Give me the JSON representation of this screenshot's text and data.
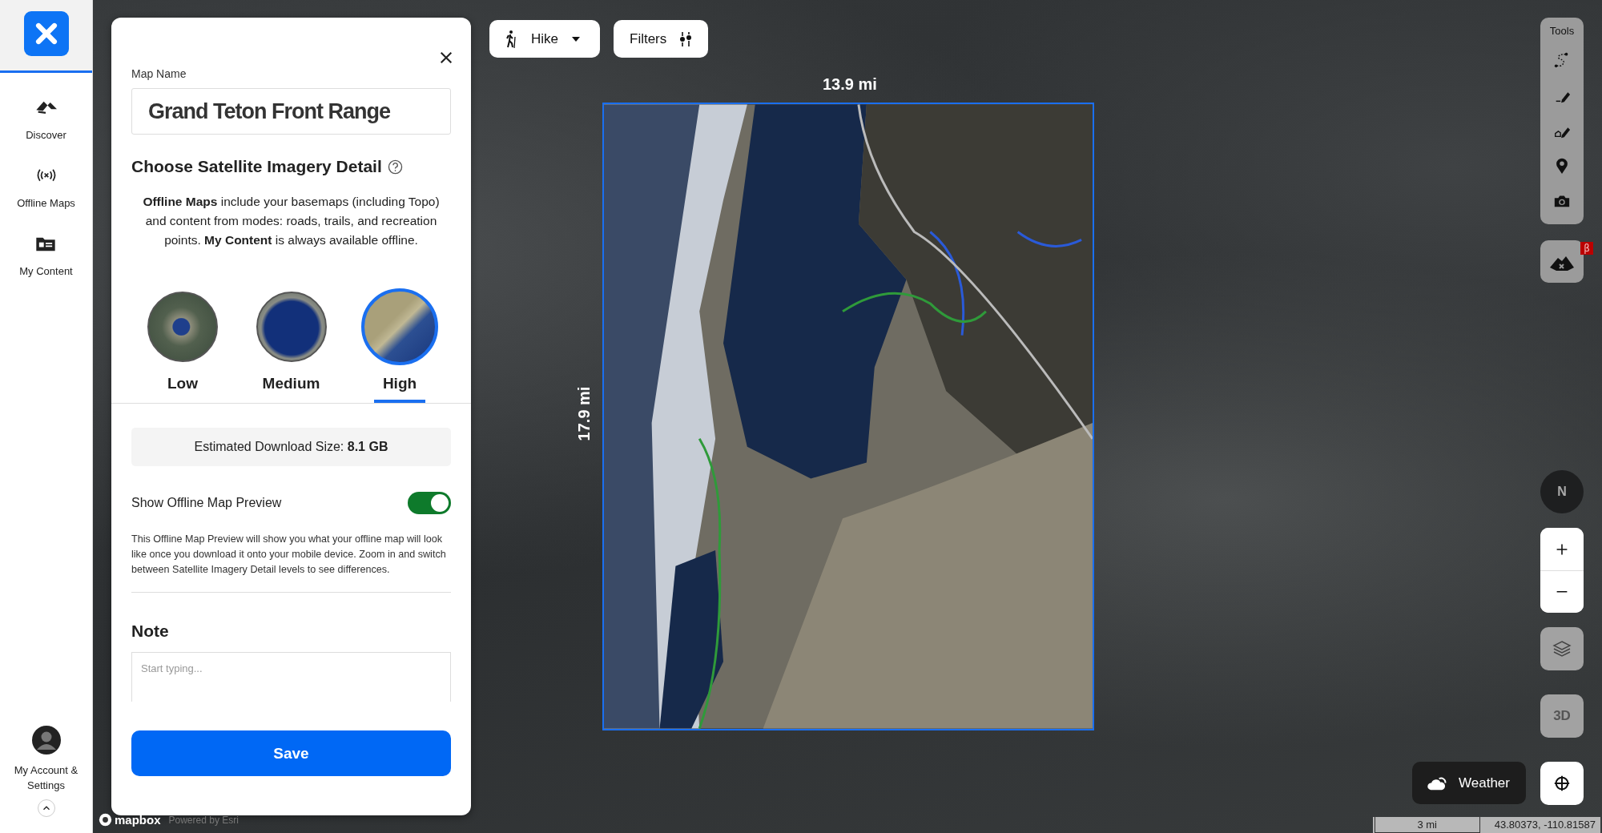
{
  "sidebar": {
    "items": [
      {
        "kind": "discover",
        "label": "Discover"
      },
      {
        "kind": "offline",
        "label": "Offline Maps"
      },
      {
        "kind": "content",
        "label": "My Content"
      }
    ],
    "account": {
      "label": "My Account & Settings"
    }
  },
  "panel": {
    "map_name_label": "Map Name",
    "map_name": "Grand Teton Front Range",
    "heading": "Choose Satellite Imagery Detail",
    "description": "**Offline Maps** include your basemaps (including Topo) and content from modes: roads, trails, and recreation points. **My Content** is always available offline.",
    "detail_options": [
      {
        "label": "Low",
        "kind": "low",
        "selected": false
      },
      {
        "label": "Medium",
        "kind": "medium",
        "selected": false
      },
      {
        "label": "High",
        "kind": "high",
        "selected": true
      }
    ],
    "download_size": "Estimated Download Size: **8.1 GB**",
    "preview_toggle": {
      "label": "Show Offline Map Preview",
      "on": true
    },
    "preview_note": "This Offline Map Preview will show you what your offline map will look like once you download it onto your mobile device. Zoom in and switch between Satellite Imagery Detail levels to see differences.",
    "note_heading": "Note",
    "note_field": {
      "placeholder": "Start typing..."
    },
    "save_button": "Save"
  },
  "toolbar": {
    "activity": "Hike",
    "filters": "Filters"
  },
  "map": {
    "width_label": "13.9 mi",
    "height_label": "17.9 mi",
    "logo": "mapbox",
    "attribution": "Powered by Esri"
  },
  "tools": {
    "title": "Tools",
    "items": [
      {
        "kind": "route"
      },
      {
        "kind": "line"
      },
      {
        "kind": "shape"
      },
      {
        "kind": "marker"
      },
      {
        "kind": "photo"
      }
    ],
    "beta_badge": "β"
  },
  "controls": {
    "compass": "N",
    "three_d": "3D",
    "weather": "Weather"
  },
  "status_bar": {
    "scale": "3 mi",
    "coordinates": "43.80373, -110.81587"
  }
}
